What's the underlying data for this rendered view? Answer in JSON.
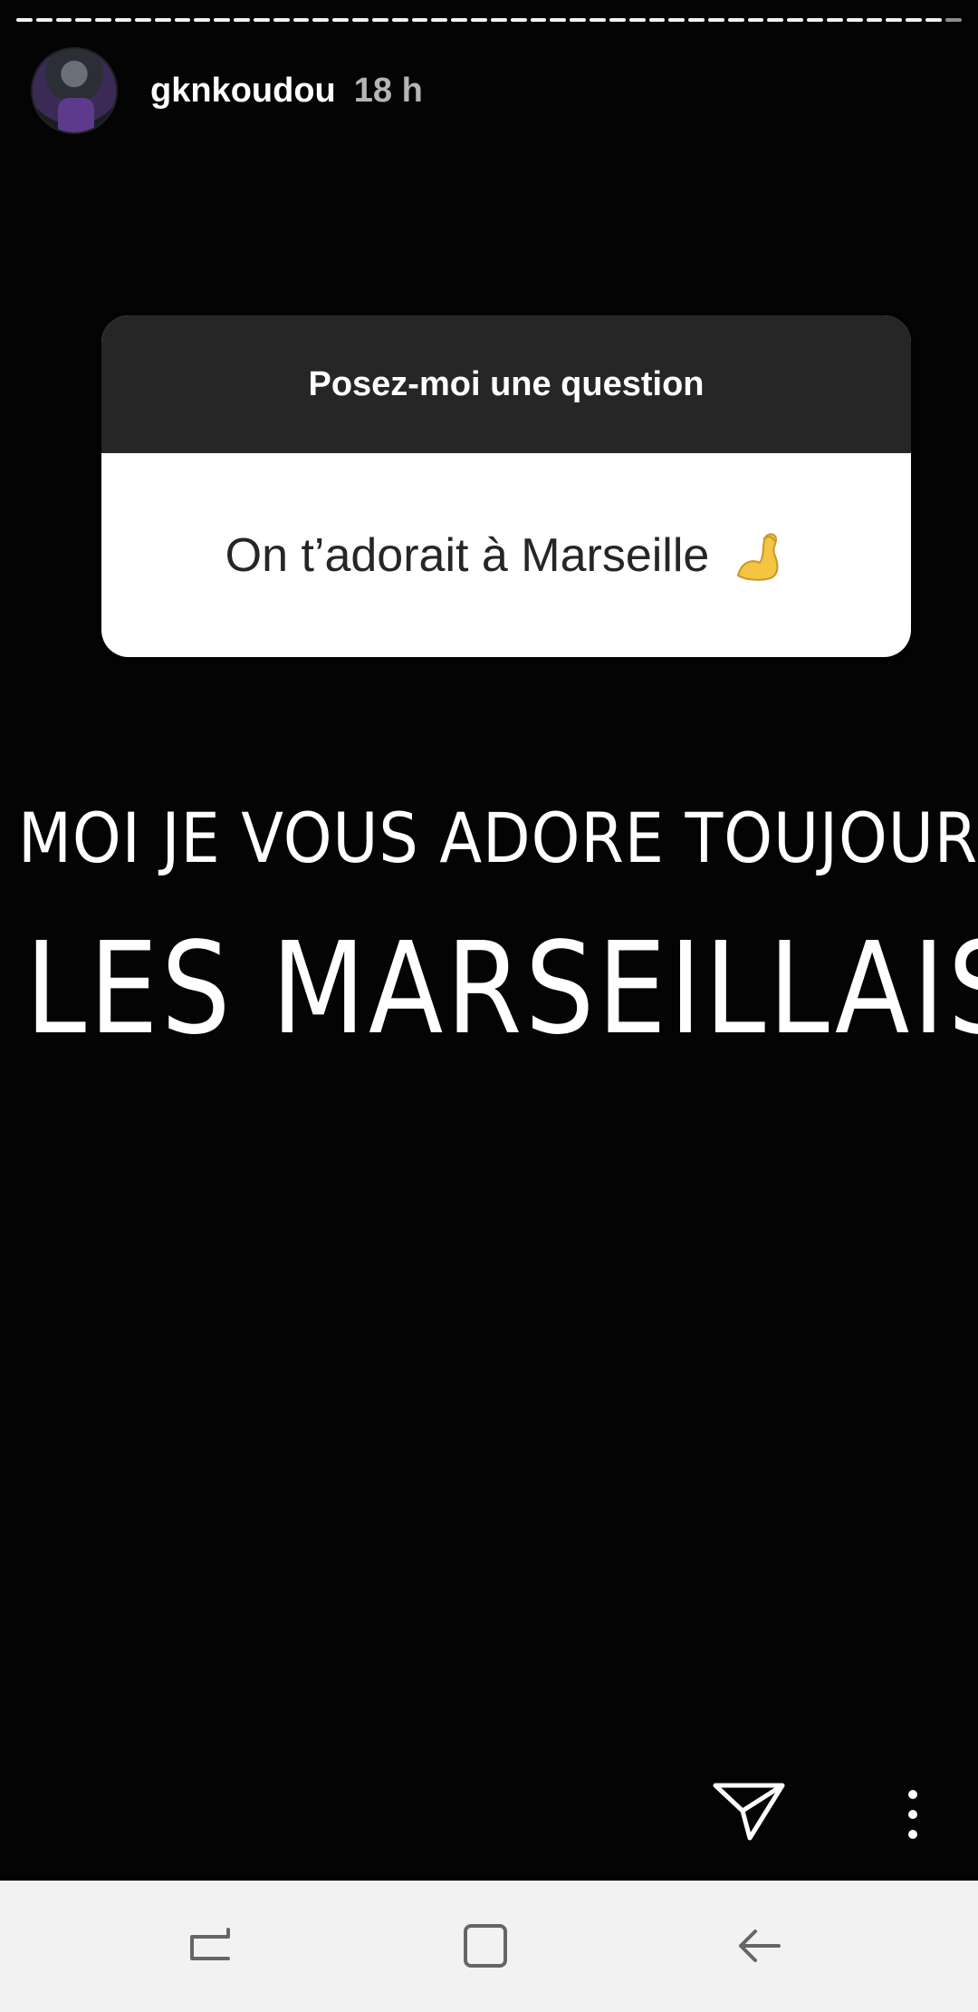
{
  "story": {
    "username": "gknkoudou",
    "time": "18 h",
    "progress_segments_total": 48,
    "progress_segments_viewed": 47
  },
  "sticker": {
    "prompt": "Posez-moi une question",
    "answer": "On t’adorait à Marseille",
    "answer_emoji_icon": "flexed-biceps-icon"
  },
  "caption": {
    "line1": "MOI JE VOUS ADORE TOUJOURS",
    "line2": "LES MARSEILLAIS"
  },
  "actions": {
    "send_icon": "send-paper-plane-icon",
    "more_icon": "more-vertical-icon"
  },
  "navbar": {
    "recents_icon": "recents-icon",
    "home_icon": "home-icon",
    "back_icon": "back-arrow-icon",
    "background": "#f2f2f2"
  },
  "colors": {
    "story_bg": "#040404",
    "sticker_header_bg": "#262626",
    "sticker_body_bg": "#ffffff"
  }
}
